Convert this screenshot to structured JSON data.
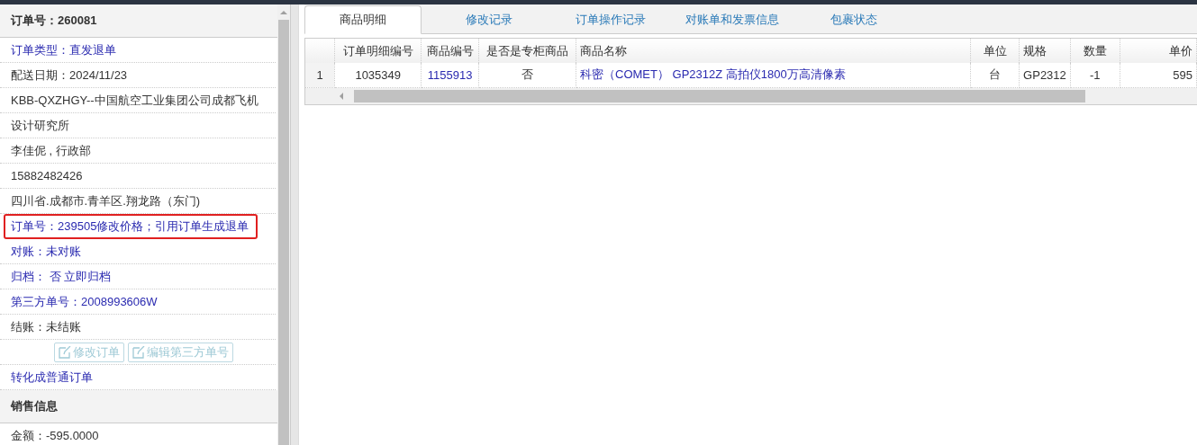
{
  "order_panel": {
    "title": "订单号：260081",
    "items": [
      {
        "kind": "link",
        "text": "订单类型：直发退单",
        "highlighted": false
      },
      {
        "kind": "text",
        "text": "配送日期：2024/11/23",
        "highlighted": false
      },
      {
        "kind": "text",
        "text": "KBB-QXZHGY--中国航空工业集团公司成都飞机",
        "highlighted": false
      },
      {
        "kind": "text",
        "text": "设计研究所",
        "highlighted": false
      },
      {
        "kind": "text",
        "text": "李佳伲 , 行政部",
        "highlighted": false
      },
      {
        "kind": "text",
        "text": "15882482426",
        "highlighted": false
      },
      {
        "kind": "text",
        "text": "四川省.成都市.青羊区.翔龙路（东门)",
        "highlighted": false
      },
      {
        "kind": "link",
        "text": "订单号：239505修改价格；引用订单生成退单",
        "highlighted": true
      },
      {
        "kind": "link",
        "text": "对账：未对账",
        "highlighted": false
      },
      {
        "kind": "link",
        "text": "归档： 否 立即归档",
        "highlighted": false
      },
      {
        "kind": "link",
        "text": "第三方单号：2008993606W",
        "highlighted": false
      },
      {
        "kind": "text",
        "text": "结账：未结账",
        "highlighted": false
      },
      {
        "kind": "buttons",
        "buttons": [
          {
            "label": "修改订单",
            "disabled": true
          },
          {
            "label": "编辑第三方单号",
            "disabled": true
          }
        ]
      },
      {
        "kind": "link",
        "text": "转化成普通订单",
        "highlighted": false
      }
    ]
  },
  "sales_panel": {
    "title": "销售信息",
    "items": [
      {
        "kind": "text",
        "text": "金额：-595.0000",
        "highlighted": false
      }
    ]
  },
  "tabs": [
    {
      "label": "商品明细",
      "selected": true
    },
    {
      "label": "修改记录",
      "selected": false
    },
    {
      "label": "订单操作记录",
      "selected": false
    },
    {
      "label": "对账单和发票信息",
      "selected": false
    },
    {
      "label": "包裹状态",
      "selected": false
    }
  ],
  "table": {
    "columns": [
      "",
      "订单明细编号",
      "商品编号",
      "是否是专柜商品",
      "商品名称",
      "单位",
      "规格",
      "数量",
      "单价"
    ],
    "rows": [
      {
        "cells": [
          {
            "text": "1",
            "kind": "text"
          },
          {
            "text": "1035349",
            "kind": "text"
          },
          {
            "text": "1155913",
            "kind": "link"
          },
          {
            "text": "否",
            "kind": "text"
          },
          {
            "text": "科密（COMET） GP2312Z 高拍仪1800万高清像素",
            "kind": "link"
          },
          {
            "text": "台",
            "kind": "text"
          },
          {
            "text": "GP2312",
            "kind": "text"
          },
          {
            "text": "-1",
            "kind": "text"
          },
          {
            "text": "595",
            "kind": "text"
          }
        ]
      }
    ]
  }
}
